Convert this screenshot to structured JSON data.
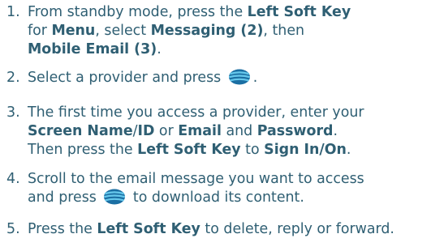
{
  "colors": {
    "text": "#2f5f73",
    "icon_dark": "#1b6fa3",
    "icon_light": "#66c8ec",
    "background": "#ffffff"
  },
  "icon": "center-select-key-icon",
  "steps": [
    {
      "number": "1.",
      "lines": [
        [
          {
            "t": "From standby mode, press the "
          },
          {
            "t": "Left Soft Key",
            "b": true
          }
        ],
        [
          {
            "t": "for "
          },
          {
            "t": "Menu",
            "b": true
          },
          {
            "t": ", select "
          },
          {
            "t": "Messaging (2)",
            "b": true
          },
          {
            "t": ", then"
          }
        ],
        [
          {
            "t": "Mobile Email (3)",
            "b": true
          },
          {
            "t": "."
          }
        ]
      ]
    },
    {
      "number": "2.",
      "lines": [
        [
          {
            "t": "Select a provider and press "
          },
          {
            "icon": true
          },
          {
            "t": "."
          }
        ]
      ]
    },
    {
      "number": "3.",
      "lines": [
        [
          {
            "t": "The first time you access a provider, enter your"
          }
        ],
        [
          {
            "t": "Screen Name",
            "b": true
          },
          {
            "t": "/"
          },
          {
            "t": "ID",
            "b": true
          },
          {
            "t": " or "
          },
          {
            "t": "Email",
            "b": true
          },
          {
            "t": " and "
          },
          {
            "t": "Password",
            "b": true
          },
          {
            "t": "."
          }
        ],
        [
          {
            "t": "Then press the "
          },
          {
            "t": "Left Soft Key",
            "b": true
          },
          {
            "t": " to "
          },
          {
            "t": "Sign In/On",
            "b": true
          },
          {
            "t": "."
          }
        ]
      ]
    },
    {
      "number": "4.",
      "lines": [
        [
          {
            "t": "Scroll to the email message you want to access"
          }
        ],
        [
          {
            "t": "and press "
          },
          {
            "icon": true
          },
          {
            "t": " to download its content."
          }
        ]
      ]
    },
    {
      "number": "5.",
      "lines": [
        [
          {
            "t": "Press the "
          },
          {
            "t": "Left Soft Key",
            "b": true
          },
          {
            "t": " to delete, reply or forward."
          }
        ]
      ]
    }
  ]
}
